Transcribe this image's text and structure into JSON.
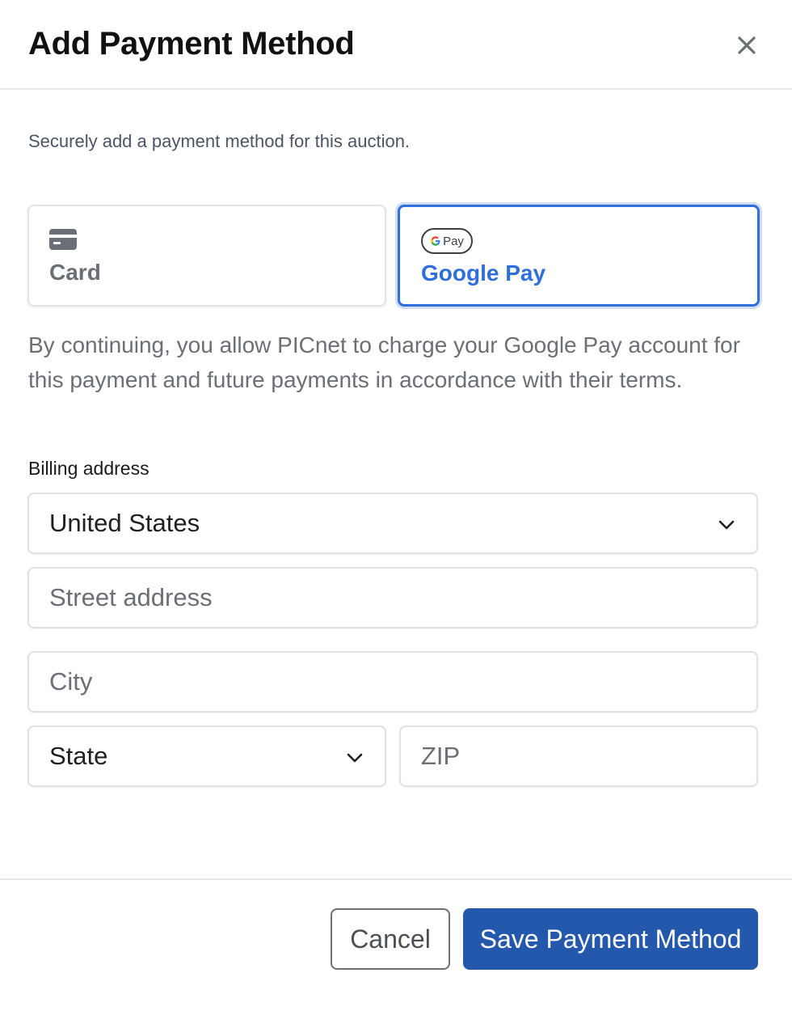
{
  "modal": {
    "title": "Add Payment Method",
    "close_icon": "close-icon",
    "subtitle": "Securely add a payment method for this auction."
  },
  "payment_methods": [
    {
      "label": "Card",
      "icon": "credit-card-icon",
      "selected": false
    },
    {
      "label": "Google Pay",
      "icon": "google-pay-icon",
      "badge_text": "Pay",
      "selected": true
    }
  ],
  "consent_text": "By continuing, you allow PICnet to charge your Google Pay account for this payment and future payments in accordance with their terms.",
  "billing": {
    "label": "Billing address",
    "country": {
      "value": "United States",
      "icon": "chevron-down-icon"
    },
    "street": {
      "placeholder": "Street address"
    },
    "city": {
      "placeholder": "City"
    },
    "state": {
      "value": "State",
      "icon": "chevron-down-icon"
    },
    "zip": {
      "placeholder": "ZIP"
    }
  },
  "footer": {
    "cancel_label": "Cancel",
    "save_label": "Save Payment Method"
  },
  "colors": {
    "accent": "#2f6fdb",
    "primary_button": "#2458ad",
    "muted_text": "#6b6f76"
  }
}
